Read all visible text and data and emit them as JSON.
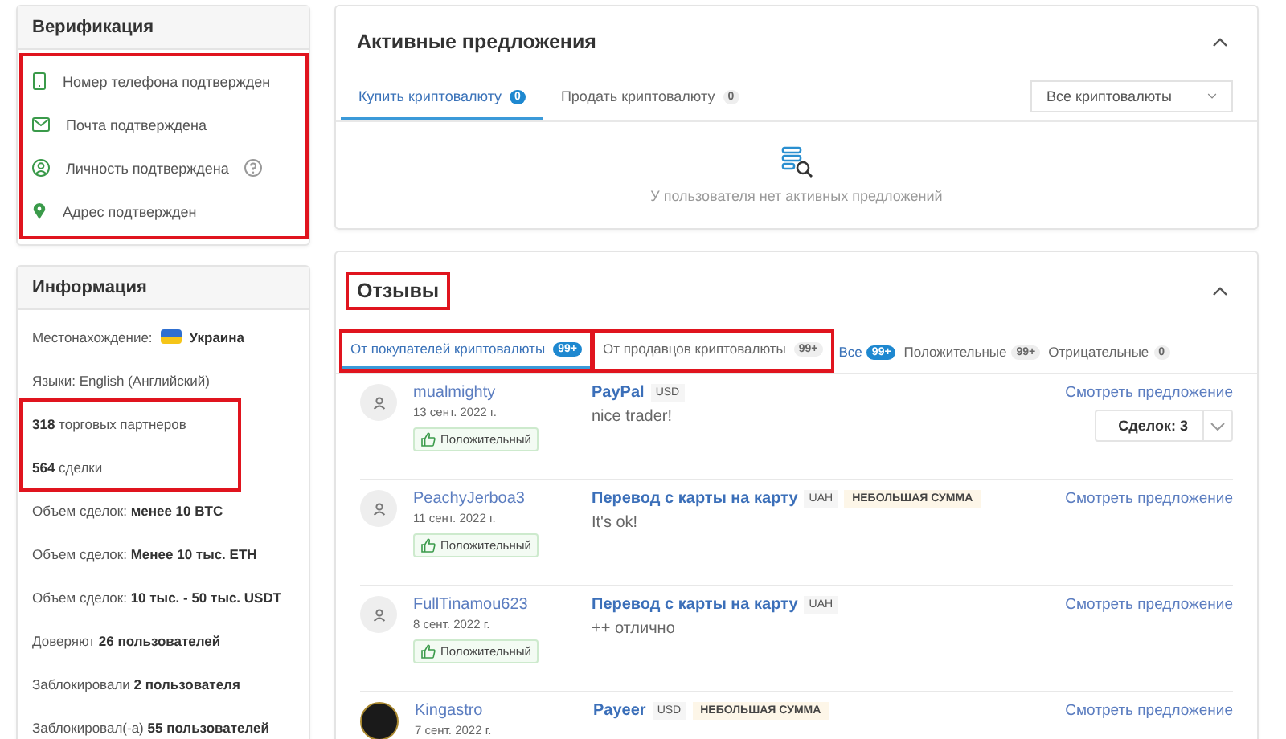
{
  "verification": {
    "title": "Верификация",
    "highlighted": true,
    "items": [
      {
        "kind": "phone",
        "label": "Номер телефона подтвержден",
        "help": false
      },
      {
        "kind": "mail",
        "label": "Почта подтверждена",
        "help": false
      },
      {
        "kind": "person",
        "label": "Личность подтверждена",
        "help": true
      },
      {
        "kind": "pin",
        "label": "Адрес подтвержден",
        "help": false
      }
    ]
  },
  "info": {
    "title": "Информация",
    "blocks": [
      {
        "highlighted": false,
        "rows": [
          {
            "kind": "location",
            "label": "Местонахождение:",
            "value": "Украина"
          },
          {
            "kind": "text",
            "text": "Языки: English (Английский)"
          }
        ]
      },
      {
        "highlighted": true,
        "rows": [
          {
            "kind": "text",
            "text": "**318** торговых партнеров"
          },
          {
            "kind": "text",
            "text": "**564** сделки"
          }
        ]
      },
      {
        "highlighted": false,
        "rows": [
          {
            "kind": "text",
            "text": "Объем сделок: **менее 10 BTC**"
          },
          {
            "kind": "text",
            "text": "Объем сделок: **Менее 10 тыс. ETH**"
          },
          {
            "kind": "text",
            "text": "Объем сделок: **10 тыс. - 50 тыс. USDT**"
          },
          {
            "kind": "text",
            "text": "Доверяют **26 пользователей**"
          },
          {
            "kind": "text",
            "text": "Заблокировали **2 пользователя**"
          },
          {
            "kind": "text",
            "text": "Заблокировал(-а) **55 пользователей**"
          }
        ]
      }
    ]
  },
  "offers": {
    "title": "Активные предложения",
    "expanded": true,
    "tabs": [
      {
        "label": "Купить криптовалюту",
        "count": "0",
        "selected": true
      },
      {
        "label": "Продать криптовалюту",
        "count": "0",
        "selected": false
      }
    ],
    "filter": "Все криптовалюты",
    "empty_text": "У пользователя нет активных предложений"
  },
  "reviews": {
    "title": "Отзывы",
    "title_highlighted": true,
    "expanded": true,
    "tabs": [
      {
        "label": "От покупателей криптовалюты",
        "count": "99+",
        "selected": true,
        "highlighted": true
      },
      {
        "label": "От продавцов криптовалюты",
        "count": "99+",
        "selected": false,
        "highlighted": true
      }
    ],
    "filters": [
      {
        "label": "Все",
        "count": "99+",
        "selected": true
      },
      {
        "label": "Положительные",
        "count": "99+",
        "selected": false
      },
      {
        "label": "Отрицательные",
        "count": "0",
        "selected": false
      }
    ],
    "items": [
      {
        "photo": false,
        "name": "mualmighty",
        "date": "13 сент. 2022 г.",
        "positive": true,
        "sentiment_label": "Положительный",
        "method": "PayPal",
        "currency": "USD",
        "comment": "nice trader!",
        "link": "Смотреть предложение",
        "deals": "Сделок: 3"
      },
      {
        "photo": false,
        "name": "PeachyJerboa3",
        "date": "11 сент. 2022 г.",
        "positive": true,
        "sentiment_label": "Положительный",
        "method": "Перевод с карты на карту",
        "currency": "UAH",
        "tags": [
          "НЕБОЛЬШАЯ СУММА"
        ],
        "comment": "It's ok!",
        "link": "Смотреть предложение"
      },
      {
        "photo": false,
        "name": "FullTinamou623",
        "date": "8 сент. 2022 г.",
        "positive": true,
        "sentiment_label": "Положительный",
        "method": "Перевод с карты на карту",
        "currency": "UAH",
        "comment": "++ отлично",
        "link": "Смотреть предложение"
      },
      {
        "photo": true,
        "name": "Kingastro",
        "date": "7 сент. 2022 г.",
        "method": "Payeer",
        "currency": "USD",
        "tags": [
          "НЕБОЛЬШАЯ СУММА"
        ],
        "link": "Смотреть предложение"
      }
    ]
  }
}
